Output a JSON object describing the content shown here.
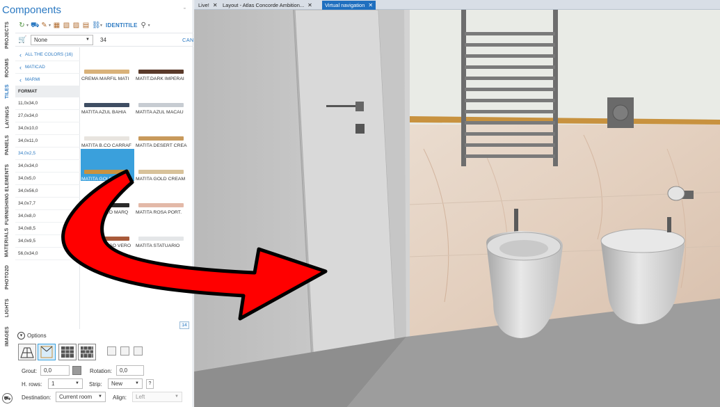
{
  "panel": {
    "title": "Components"
  },
  "side_tabs": [
    "PROJECTS",
    "ROOMS",
    "TILES",
    "LAYINGS",
    "PANELS",
    "FURNISHING ELEMENTS",
    "MATERIALS",
    "PHOTO2D",
    "LIGHTS",
    "IMAGES"
  ],
  "active_side_tab": "TILES",
  "toolbar": {
    "brand_label": "IDENTITILE"
  },
  "filter": {
    "price_select_value": "None",
    "search_value": "34",
    "cancel_label": "CANCEL"
  },
  "nav": {
    "all_colors": "ALL THE COLORS (16)",
    "maticad": "MATICAD",
    "marmi": "MARMI"
  },
  "format": {
    "header": "FORMAT",
    "items": [
      "11,0x34,0",
      "27,0x34,0",
      "34,0x10,0",
      "34,0x11,0",
      "34,0x2,5",
      "34,0x34,0",
      "34,0x5,0",
      "34,0x56,0",
      "34,0x7,7",
      "34,0x8,0",
      "34,0x8,5",
      "34,0x9,5",
      "56,0x34,0"
    ],
    "selected": "34,0x2,5"
  },
  "tiles": [
    {
      "label": "CREMA MARFIL MATI",
      "color": "#d9b27a"
    },
    {
      "label": "MATIT.DARK IMPERAI",
      "color": "#5a3a2a"
    },
    {
      "label": "MATITA AZUL BAHIA",
      "color": "#3f4e63"
    },
    {
      "label": "MATITA AZUL MACAU",
      "color": "#c7ccd2"
    },
    {
      "label": "MATITA B.CO CARRAF",
      "color": "#e8e4df"
    },
    {
      "label": "MATITA DESERT CREA",
      "color": "#c89a5c"
    },
    {
      "label": "MATITA GOLD PERSI",
      "color": "#c8923f"
    },
    {
      "label": "MATITA GOLD CREAM",
      "color": "#d8c29a"
    },
    {
      "label": "MATITA NERO MARQ",
      "color": "#2b2b2b"
    },
    {
      "label": "MATITA ROSA PORT.",
      "color": "#e3b9a8"
    },
    {
      "label": "MATITA ROSSO VERO",
      "color": "#a85a3a"
    },
    {
      "label": "MATITA STATUARIO",
      "color": "#e4e6e8"
    }
  ],
  "selected_tile": "MATITA GOLD PERSI",
  "tile_count": "14",
  "options": {
    "label": "Options",
    "grout_label": "Grout:",
    "grout_value": "0,0",
    "grout_color": "#9a9a9a",
    "rotation_label": "Rotation:",
    "rotation_value": "0,0",
    "hrows_label": "H. rows:",
    "hrows_value": "1",
    "strip_label": "Strip:",
    "strip_value": "New",
    "help_label": "?",
    "destination_label": "Destination:",
    "destination_value": "Current room",
    "align_label": "Align:",
    "align_value": "Left"
  },
  "doc_tabs": [
    {
      "label": "Live!",
      "close": "✕",
      "active": false
    },
    {
      "label": "Layout - Atlas Concorde Ambition...",
      "close": "✕",
      "active": false
    },
    {
      "label": "Virtual navigation",
      "close": "✕",
      "active": true
    }
  ],
  "colors": {
    "accent": "#2b79c2",
    "selection": "#3aa0dc",
    "arrow": "#ff0000"
  }
}
